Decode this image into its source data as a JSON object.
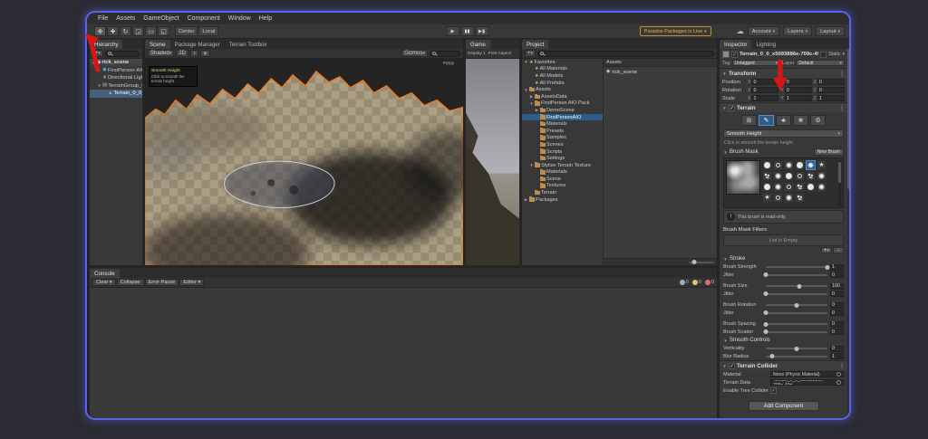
{
  "menubar": {
    "items": [
      "File",
      "Assets",
      "GameObject",
      "Component",
      "Window",
      "Help"
    ]
  },
  "toolbar": {
    "tools": [
      {
        "name": "hand-tool",
        "glyph": "✥"
      },
      {
        "name": "move-tool",
        "glyph": "✚"
      },
      {
        "name": "rotate-tool",
        "glyph": "↻"
      },
      {
        "name": "scale-tool",
        "glyph": "◲"
      },
      {
        "name": "rect-tool",
        "glyph": "▭"
      },
      {
        "name": "transform-tool",
        "glyph": "◱"
      }
    ],
    "pivot_label": "Center",
    "space_label": "Local",
    "play_label": "▶",
    "pause_label": "▮▮",
    "step_label": "▶▮",
    "collab_label": "Paradox Packages is Live",
    "account_label": "Account",
    "layers_label": "Layers",
    "layout_label": "Layout"
  },
  "hierarchy": {
    "tab": "Hierarchy",
    "add_label": "+",
    "items": [
      {
        "label": "rick_scene",
        "icon": "scene",
        "indent": 0,
        "arrow": "▼",
        "header": true
      },
      {
        "label": "FirstPerson-AIO",
        "icon": "player",
        "indent": 1,
        "arrow": "▶"
      },
      {
        "label": "Directional Light",
        "icon": "light",
        "indent": 1,
        "arrow": ""
      },
      {
        "label": "TerrainGroup_0",
        "icon": "group",
        "indent": 1,
        "arrow": "▼"
      },
      {
        "label": "Terrain_0_0_x50938...",
        "icon": "terrain",
        "indent": 2,
        "arrow": "",
        "selected": true
      }
    ]
  },
  "scene": {
    "tabs": [
      "Scene",
      "Package Manager",
      "Terrain Toolbox"
    ],
    "active_tab": "Scene",
    "shading_mode": "Shaded",
    "toggle_2d": "2D",
    "gizmos_label": "Gizmos",
    "axis_label": "Persp",
    "tooltip": {
      "title": "Smooth Height",
      "line1": "Click to smooth the",
      "line2": "terrain height."
    }
  },
  "game": {
    "tab": "Game",
    "display": "Display 1",
    "aspect": "Free Aspect"
  },
  "project": {
    "tab": "Project",
    "add_label": "+",
    "breadcrumb": "Assets",
    "selected_asset": "rick_scene",
    "tree": [
      {
        "label": "Favorites",
        "indent": 0,
        "arrow": "▼",
        "icon": "star"
      },
      {
        "label": "All Materials",
        "indent": 1,
        "arrow": "",
        "icon": "star"
      },
      {
        "label": "All Models",
        "indent": 1,
        "arrow": "",
        "icon": "star"
      },
      {
        "label": "All Prefabs",
        "indent": 1,
        "arrow": "",
        "icon": "star"
      },
      {
        "label": "Assets",
        "indent": 0,
        "arrow": "▼",
        "icon": "folder"
      },
      {
        "label": "AssetsData",
        "indent": 1,
        "arrow": "▶",
        "icon": "folder"
      },
      {
        "label": "FirstPerson AIO Pack",
        "indent": 1,
        "arrow": "▼",
        "icon": "folder"
      },
      {
        "label": "DemoScene",
        "indent": 2,
        "arrow": "▶",
        "icon": "folder"
      },
      {
        "label": "FirstPersonAIO",
        "indent": 2,
        "arrow": "",
        "icon": "folder",
        "selected": true
      },
      {
        "label": "Materials",
        "indent": 2,
        "arrow": "",
        "icon": "folder"
      },
      {
        "label": "Presets",
        "indent": 2,
        "arrow": "",
        "icon": "folder"
      },
      {
        "label": "Samples",
        "indent": 2,
        "arrow": "",
        "icon": "folder"
      },
      {
        "label": "Scenes",
        "indent": 2,
        "arrow": "",
        "icon": "folder"
      },
      {
        "label": "Scripts",
        "indent": 2,
        "arrow": "",
        "icon": "folder"
      },
      {
        "label": "Settings",
        "indent": 2,
        "arrow": "",
        "icon": "folder"
      },
      {
        "label": "Stylize Terrain Texture",
        "indent": 1,
        "arrow": "▼",
        "icon": "folder"
      },
      {
        "label": "Materials",
        "indent": 2,
        "arrow": "",
        "icon": "folder"
      },
      {
        "label": "Scene",
        "indent": 2,
        "arrow": "",
        "icon": "folder"
      },
      {
        "label": "Textures",
        "indent": 2,
        "arrow": "",
        "icon": "folder"
      },
      {
        "label": "Terrain",
        "indent": 1,
        "arrow": "",
        "icon": "folder"
      },
      {
        "label": "Packages",
        "indent": 0,
        "arrow": "▶",
        "icon": "folder"
      }
    ]
  },
  "console": {
    "tab": "Console",
    "buttons": [
      "Clear ▾",
      "Collapse",
      "Error Pause",
      "Editor ▾"
    ],
    "counts": [
      {
        "type": "info",
        "value": "0"
      },
      {
        "type": "warning",
        "value": "0"
      },
      {
        "type": "error",
        "value": "0"
      }
    ]
  },
  "inspector": {
    "tabs": [
      "Inspector",
      "Lighting"
    ],
    "active_tab": "Inspector",
    "object": {
      "name": "Terrain_0_0_x5093886e-709c-49d0-bf8d-1e78",
      "static_label": "Static"
    },
    "tag_label": "Tag",
    "tag_value": "Untagged",
    "layer_label": "Layer",
    "layer_value": "Default",
    "transform": {
      "header": "Transform",
      "rows": [
        {
          "label": "Position",
          "x": "0",
          "y": "0",
          "z": "0"
        },
        {
          "label": "Rotation",
          "x": "0",
          "y": "0",
          "z": "0"
        },
        {
          "label": "Scale",
          "x": "1",
          "y": "1",
          "z": "1"
        }
      ]
    },
    "terrain": {
      "header": "Terrain",
      "tools": [
        {
          "name": "create-neighbor-terrains-tool",
          "glyph": "⊞",
          "active": false
        },
        {
          "name": "paint-terrain-tool",
          "glyph": "✎",
          "active": true
        },
        {
          "name": "paint-trees-tool",
          "glyph": "♣",
          "active": false
        },
        {
          "name": "paint-details-tool",
          "glyph": "❀",
          "active": false
        },
        {
          "name": "terrain-settings-tool",
          "glyph": "⚙",
          "active": false
        }
      ],
      "mode_dropdown": "Smooth Height",
      "hint": "Click to smooth the terrain height.",
      "brushes_header": "Brush Mask",
      "new_brush_label": "New Brush",
      "brushes": {
        "selected_index": 4,
        "types": [
          "solid",
          "ring",
          "soft",
          "solid",
          "soft",
          "star",
          "spray",
          "soft",
          "solid",
          "ring",
          "spray",
          "soft",
          "solid",
          "soft",
          "ring",
          "spray",
          "solid",
          "soft",
          "star",
          "ring",
          "soft",
          "spray"
        ]
      },
      "readonly_notice": "This brush is read-only.",
      "filters_header": "Brush Mask Filters",
      "filters_empty": "List is Empty",
      "add_filter_label": "+",
      "remove_filter_label": "-",
      "stroke_header": "Stroke",
      "stroke_sliders": [
        {
          "label": "Brush Strength",
          "value": "1",
          "knob": 1
        },
        {
          "label": "Jitter",
          "value": "0",
          "knob": 0
        },
        {
          "label": "Brush Size",
          "value": "100",
          "knob": 0.55
        },
        {
          "label": "Jitter",
          "value": "0",
          "knob": 0
        },
        {
          "label": "Brush Rotation",
          "value": "0",
          "knob": 0.5
        },
        {
          "label": "Jitter",
          "value": "0",
          "knob": 0
        },
        {
          "label": "Brush Spacing",
          "value": "0",
          "knob": 0
        },
        {
          "label": "Brush Scatter",
          "value": "0",
          "knob": 0
        }
      ],
      "smooth_header": "Smooth Controls",
      "smooth_sliders": [
        {
          "label": "Verticality",
          "value": "0",
          "knob": 0.5
        },
        {
          "label": "Blur Radius",
          "value": "1",
          "knob": 0.1
        }
      ]
    },
    "collider": {
      "header": "Terrain Collider",
      "material_label": "Material",
      "material_value": "None (Physic Material)",
      "data_label": "Terrain Data",
      "data_value": "Terrain_0_0_x5093886e-709c-49d...",
      "trees_label": "Enable Tree Colliders"
    },
    "add_component_label": "Add Component"
  }
}
